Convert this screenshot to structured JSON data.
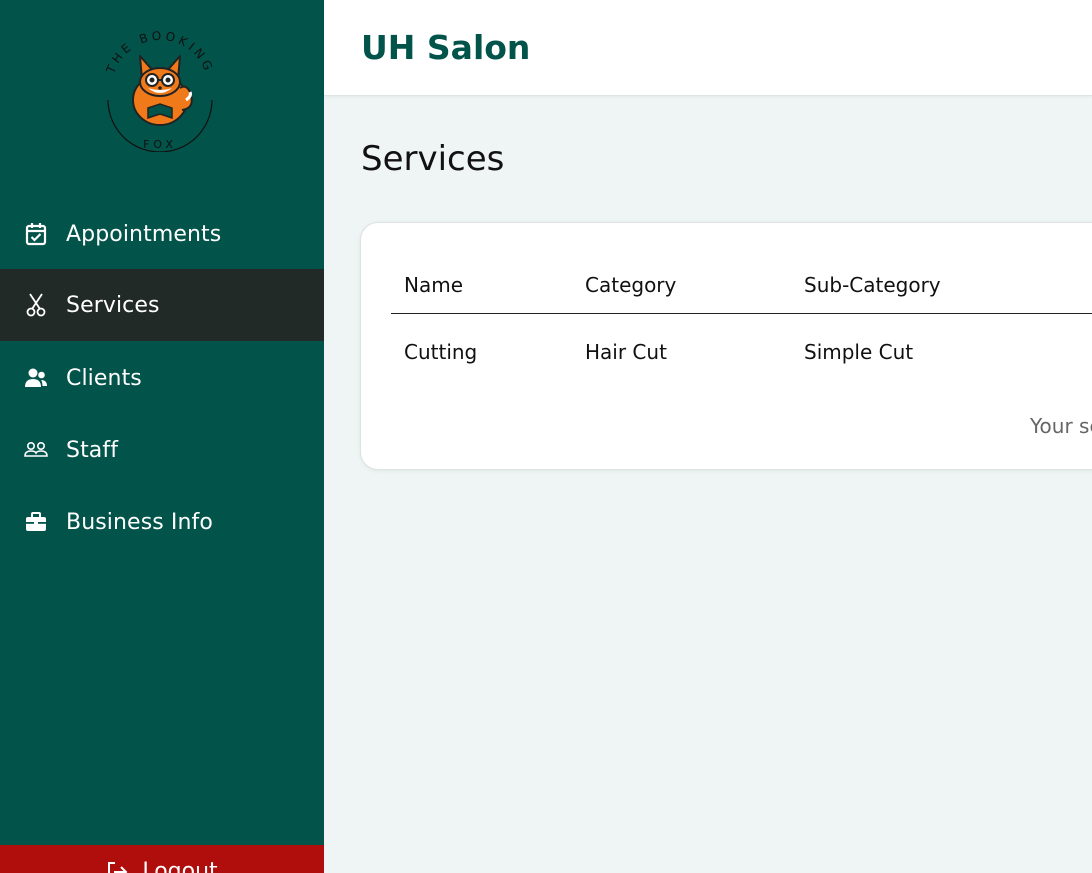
{
  "app": {
    "title": "UH Salon"
  },
  "logo": {
    "arc_top": "THE BOOKING",
    "arc_bottom": "FOX"
  },
  "sidebar": {
    "items": [
      {
        "label": "Appointments",
        "icon": "calendar-check-icon",
        "active": false
      },
      {
        "label": "Services",
        "icon": "scissors-icon",
        "active": true
      },
      {
        "label": "Clients",
        "icon": "users-icon",
        "active": false
      },
      {
        "label": "Staff",
        "icon": "staff-icon",
        "active": false
      },
      {
        "label": "Business Info",
        "icon": "briefcase-icon",
        "active": false
      }
    ],
    "logout_label": "Logout"
  },
  "main": {
    "page_title": "Services",
    "table": {
      "headers": [
        "Name",
        "Category",
        "Sub-Category"
      ],
      "rows": [
        [
          "Cutting",
          "Hair Cut",
          "Simple Cut"
        ]
      ],
      "footer_note": "Your se"
    }
  },
  "colors": {
    "sidebar_bg": "#02534a",
    "sidebar_active_bg": "#222a28",
    "logout_bg": "#b00d0d",
    "accent": "#02534a",
    "page_bg": "#eef5f4"
  }
}
